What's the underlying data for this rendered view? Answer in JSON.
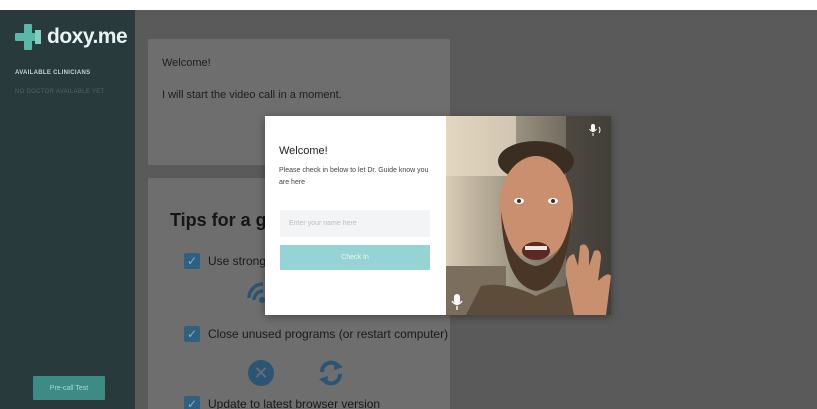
{
  "sidebar": {
    "logo_text": "doxy.me",
    "heading": "AVAILABLE CLINICIANS",
    "subtext": "NO DOCTOR AVAILABLE YET",
    "precall_label": "Pre-call Test"
  },
  "main": {
    "welcome_title": "Welcome!",
    "welcome_message": "I will start the video call in a moment.",
    "tips_title": "Tips for a g",
    "tips": [
      "Use strong",
      "Close unused programs (or restart computer)",
      "Update to latest browser version"
    ]
  },
  "modal": {
    "title": "Welcome!",
    "text": "Please check in below to let Dr. Guide know you are here",
    "input_placeholder": "Enter your name here",
    "input_value": "",
    "checkin_label": "Check In"
  },
  "colors": {
    "accent": "#5bb8a8",
    "checkin_button": "#96d3d4",
    "sidebar_bg": "#283a3b",
    "overlay_bg": "#5a5a5a"
  },
  "icons": [
    "doxy-logo-icon",
    "checkbox-icon",
    "wifi-icon",
    "close-circle-icon",
    "sync-icon",
    "microphone-icon"
  ]
}
